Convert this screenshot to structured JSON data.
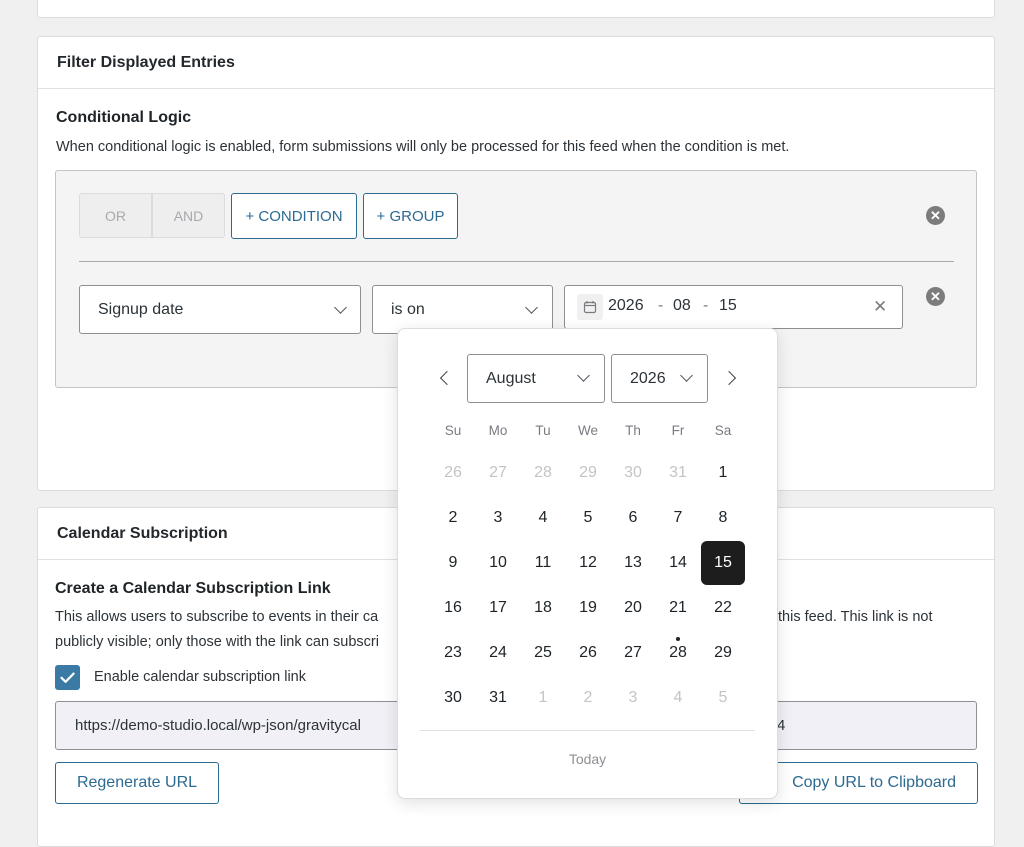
{
  "filter_panel": {
    "title": "Filter Displayed Entries",
    "logic_heading": "Conditional Logic",
    "logic_desc": "When conditional logic is enabled, form submissions will only be processed for this feed when the condition is met.",
    "toggle": {
      "or": "OR",
      "and": "AND"
    },
    "add_condition": "+ CONDITION",
    "add_group": "+ GROUP",
    "condition": {
      "field": "Signup date",
      "operator": "is on",
      "date": {
        "year": "2026",
        "month": "08",
        "day": "15",
        "sep": "-"
      }
    }
  },
  "datepicker": {
    "month": "August",
    "year": "2026",
    "weekdays": [
      "Su",
      "Mo",
      "Tu",
      "We",
      "Th",
      "Fr",
      "Sa"
    ],
    "weeks": [
      [
        "26",
        "27",
        "28",
        "29",
        "30",
        "31",
        "1"
      ],
      [
        "2",
        "3",
        "4",
        "5",
        "6",
        "7",
        "8"
      ],
      [
        "9",
        "10",
        "11",
        "12",
        "13",
        "14",
        "15"
      ],
      [
        "16",
        "17",
        "18",
        "19",
        "20",
        "21",
        "22"
      ],
      [
        "23",
        "24",
        "25",
        "26",
        "27",
        "28",
        "29"
      ],
      [
        "30",
        "31",
        "1",
        "2",
        "3",
        "4",
        "5"
      ]
    ],
    "selected_day": "15",
    "today_button": "Today"
  },
  "calendar_panel": {
    "title": "Calendar Subscription",
    "heading": "Create a Calendar Subscription Link",
    "desc_line1_left": "This allows users to subscribe to events in their ca",
    "desc_line1_right": "this feed. This link is not",
    "desc_line2_left": "publicly visible; only those with the link can subscri",
    "checkbox_label": "Enable calendar subscription link",
    "url_left": "https://demo-studio.local/wp-json/gravitycal",
    "url_right": "4",
    "regenerate": "Regenerate URL",
    "copy": "Copy URL to Clipboard"
  },
  "colors": {
    "primary": "#2c6a91",
    "checkbox": "#3a7aa5",
    "selected_day": "#1d1d1d"
  }
}
